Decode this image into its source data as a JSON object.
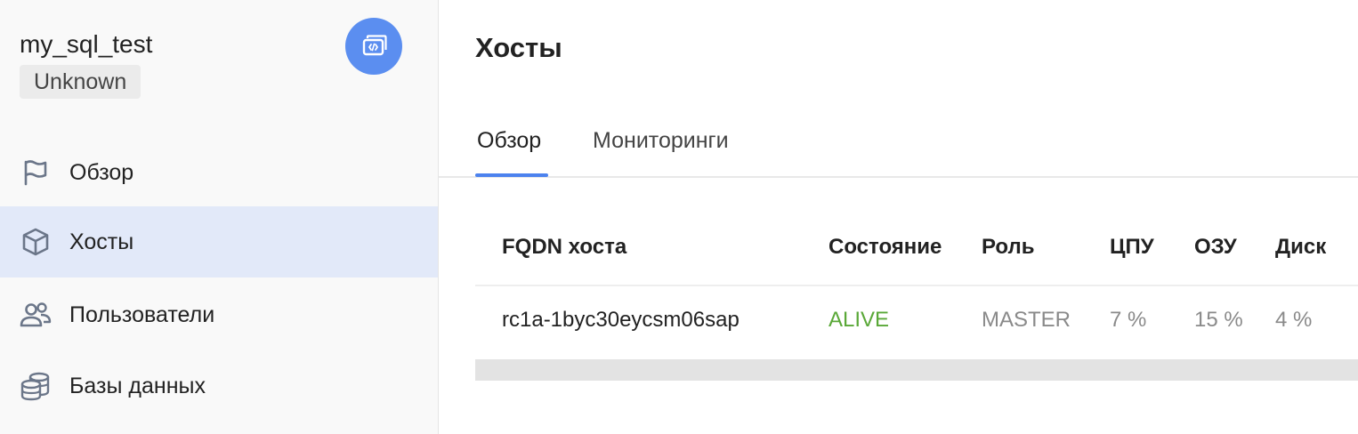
{
  "sidebar": {
    "cluster_name": "my_sql_test",
    "status": "Unknown",
    "code_button_icon": "code-window-icon",
    "items": [
      {
        "label": "Обзор",
        "icon": "flag-icon",
        "active": false
      },
      {
        "label": "Хосты",
        "icon": "cube-icon",
        "active": true
      },
      {
        "label": "Пользователи",
        "icon": "users-icon",
        "active": false
      },
      {
        "label": "Базы данных",
        "icon": "database-icon",
        "active": false
      }
    ]
  },
  "main": {
    "title": "Хосты",
    "tabs": [
      {
        "label": "Обзор",
        "active": true
      },
      {
        "label": "Мониторинги",
        "active": false
      }
    ],
    "table": {
      "headers": [
        "FQDN хоста",
        "Состояние",
        "Роль",
        "ЦПУ",
        "ОЗУ",
        "Диск"
      ],
      "rows": [
        [
          "rc1a-1byc30eycsm06sap",
          "ALIVE",
          "MASTER",
          "7 %",
          "15 %",
          "4 %"
        ]
      ]
    }
  },
  "colors": {
    "accent": "#4c82ee",
    "alive": "#5aa838",
    "active_nav_bg": "#e2e9f9"
  }
}
